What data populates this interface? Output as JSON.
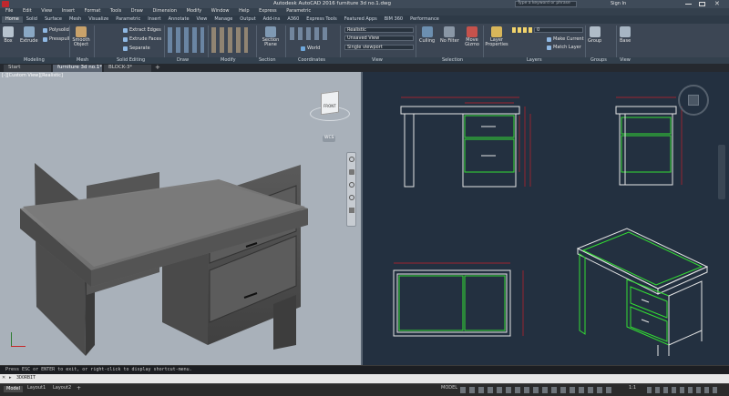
{
  "app": {
    "title": "Autodesk AutoCAD 2016    furniture 3d no.1.dwg",
    "search_placeholder": "Type a keyword or phrase",
    "sign_in": "Sign In"
  },
  "menu": [
    "File",
    "Edit",
    "View",
    "Insert",
    "Format",
    "Tools",
    "Draw",
    "Dimension",
    "Modify",
    "Window",
    "Help",
    "Express",
    "Parametric"
  ],
  "ribbon_tabs": [
    "Home",
    "Solid",
    "Surface",
    "Mesh",
    "Visualize",
    "Parametric",
    "Insert",
    "Annotate",
    "View",
    "Manage",
    "Output",
    "Add-ins",
    "A360",
    "Express Tools",
    "Featured Apps",
    "BIM 360",
    "Performance"
  ],
  "ribbon": {
    "box": "Box",
    "extrude": "Extrude",
    "polysolid": "Polysolid",
    "presspull": "Presspull",
    "smooth_object": "Smooth Object",
    "extract_edges": "Extract Edges",
    "extrude_faces": "Extrude Faces",
    "separate": "Separate",
    "section_plane": "Section Plane",
    "world": "World",
    "visual_style": "Realistic",
    "view_name": "Unsaved View",
    "single_viewport": "Single viewport",
    "culling": "Culling",
    "no_filter": "No Filter",
    "move_gizmo": "Move Gizmo",
    "layer_properties": "Layer Properties",
    "make_current": "Make Current",
    "match_layer": "Match Layer",
    "layer_value": "0",
    "group": "Group",
    "base": "Base"
  },
  "panels": [
    "Modeling",
    "Mesh",
    "Solid Editing",
    "Draw",
    "Modify",
    "Section",
    "Coordinates",
    "View",
    "Selection",
    "Layers",
    "Groups",
    "View"
  ],
  "doc_tabs": [
    "Start",
    "furniture 3d no.1*",
    "BLOCK-3*"
  ],
  "viewport": {
    "label": "[-][Custom View][Realistic]",
    "viewcube_face": "FRONT",
    "wcs": "WCS"
  },
  "command": {
    "history": "Press ESC or ENTER to exit, or right-click to display shortcut-menu.",
    "prompt": "3DORBIT"
  },
  "status": {
    "tabs": [
      "Model",
      "Layout1",
      "Layout2"
    ],
    "mode": "MODEL",
    "scale": "1:1"
  },
  "colors": {
    "viewport_bg": "#a9b1ba",
    "drawing_bg": "#233040",
    "lines_white": "#e6e6e6",
    "lines_green": "#33dd33",
    "dims_red": "#c8202a"
  }
}
